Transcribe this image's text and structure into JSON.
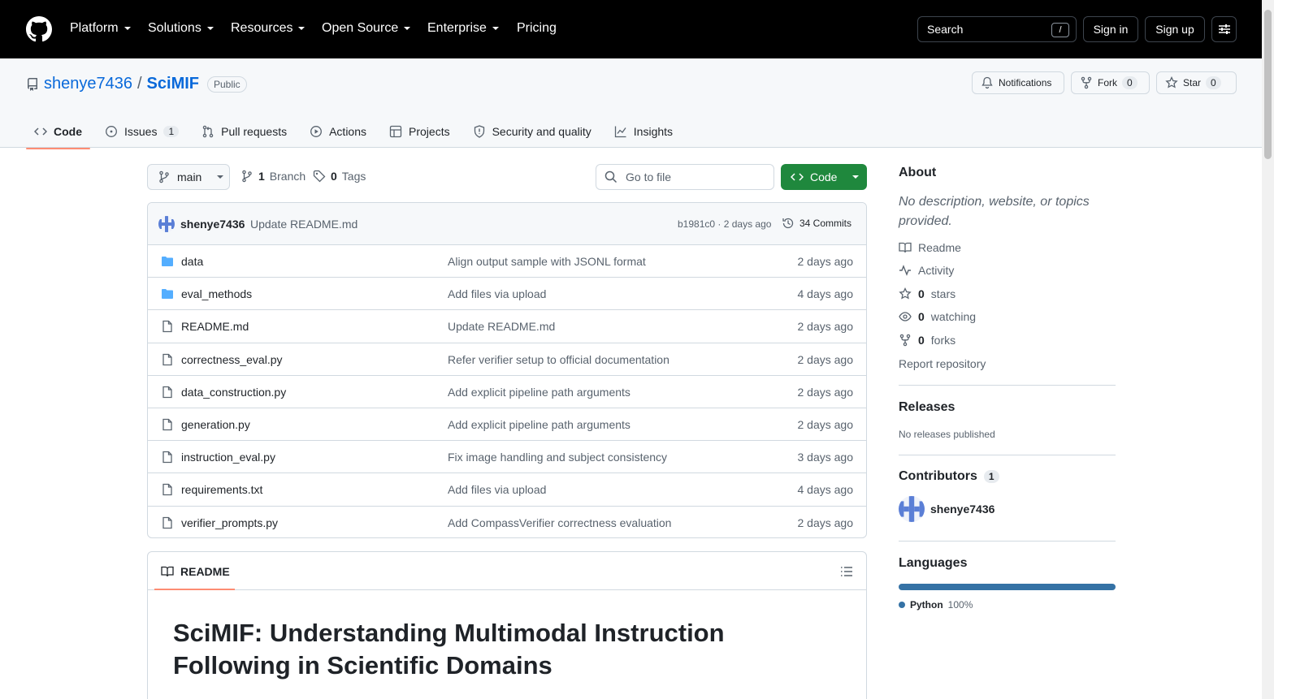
{
  "header": {
    "nav": [
      {
        "label": "Platform",
        "caret": true
      },
      {
        "label": "Solutions",
        "caret": true
      },
      {
        "label": "Resources",
        "caret": true
      },
      {
        "label": "Open Source",
        "caret": true
      },
      {
        "label": "Enterprise",
        "caret": true
      },
      {
        "label": "Pricing",
        "caret": false
      }
    ],
    "search_label": "Search",
    "search_shortcut": "/",
    "sign_in": "Sign in",
    "sign_up": "Sign up"
  },
  "repo": {
    "owner": "shenye7436",
    "separator": "/",
    "name": "SciMIF",
    "visibility": "Public",
    "notifications_label": "Notifications",
    "fork_label": "Fork",
    "fork_count": "0",
    "star_label": "Star",
    "star_count": "0"
  },
  "tabs": [
    {
      "label": "Code",
      "icon": "code-icon",
      "selected": true
    },
    {
      "label": "Issues",
      "icon": "issue-icon",
      "count": "1"
    },
    {
      "label": "Pull requests",
      "icon": "pull-request-icon"
    },
    {
      "label": "Actions",
      "icon": "play-icon"
    },
    {
      "label": "Projects",
      "icon": "table-icon"
    },
    {
      "label": "Security and quality",
      "icon": "shield-icon"
    },
    {
      "label": "Insights",
      "icon": "graph-icon"
    }
  ],
  "toolbar": {
    "branch": "main",
    "branch_count": "1",
    "branch_label": "Branch",
    "tag_count": "0",
    "tag_label": "Tags",
    "goto_placeholder": "Go to file",
    "code_button": "Code"
  },
  "latest_commit": {
    "author": "shenye7436",
    "message": "Update README.md",
    "hash_time": "b1981c0 · 2 days ago",
    "commits": "34 Commits"
  },
  "files": [
    {
      "name": "data",
      "type": "dir",
      "commit": "Align output sample with JSONL format",
      "age": "2 days ago"
    },
    {
      "name": "eval_methods",
      "type": "dir",
      "commit": "Add files via upload",
      "age": "4 days ago"
    },
    {
      "name": "README.md",
      "type": "file",
      "commit": "Update README.md",
      "age": "2 days ago"
    },
    {
      "name": "correctness_eval.py",
      "type": "file",
      "commit": "Refer verifier setup to official documentation",
      "age": "2 days ago"
    },
    {
      "name": "data_construction.py",
      "type": "file",
      "commit": "Add explicit pipeline path arguments",
      "age": "2 days ago"
    },
    {
      "name": "generation.py",
      "type": "file",
      "commit": "Add explicit pipeline path arguments",
      "age": "2 days ago"
    },
    {
      "name": "instruction_eval.py",
      "type": "file",
      "commit": "Fix image handling and subject consistency",
      "age": "3 days ago"
    },
    {
      "name": "requirements.txt",
      "type": "file",
      "commit": "Add files via upload",
      "age": "4 days ago"
    },
    {
      "name": "verifier_prompts.py",
      "type": "file",
      "commit": "Add CompassVerifier correctness evaluation",
      "age": "2 days ago"
    }
  ],
  "readme": {
    "tab_label": "README",
    "heading": "SciMIF: Understanding Multimodal Instruction Following in Scientific Domains"
  },
  "sidebar": {
    "about_title": "About",
    "about_desc": "No description, website, or topics provided.",
    "readme_link": "Readme",
    "activity_link": "Activity",
    "stars_count": "0",
    "stars_label": "stars",
    "watching_count": "0",
    "watching_label": "watching",
    "forks_count": "0",
    "forks_label": "forks",
    "report_link": "Report repository",
    "releases_title": "Releases",
    "releases_empty": "No releases published",
    "contributors_title": "Contributors",
    "contributors_count": "1",
    "contributor_name": "shenye7436",
    "languages_title": "Languages",
    "language_name": "Python",
    "language_pct": "100%",
    "language_color": "#3572a5"
  },
  "colors": {
    "header_bg": "#000000",
    "accent_link": "#0969da",
    "primary_button": "#1f883d",
    "tab_underline": "#fd8c73"
  }
}
